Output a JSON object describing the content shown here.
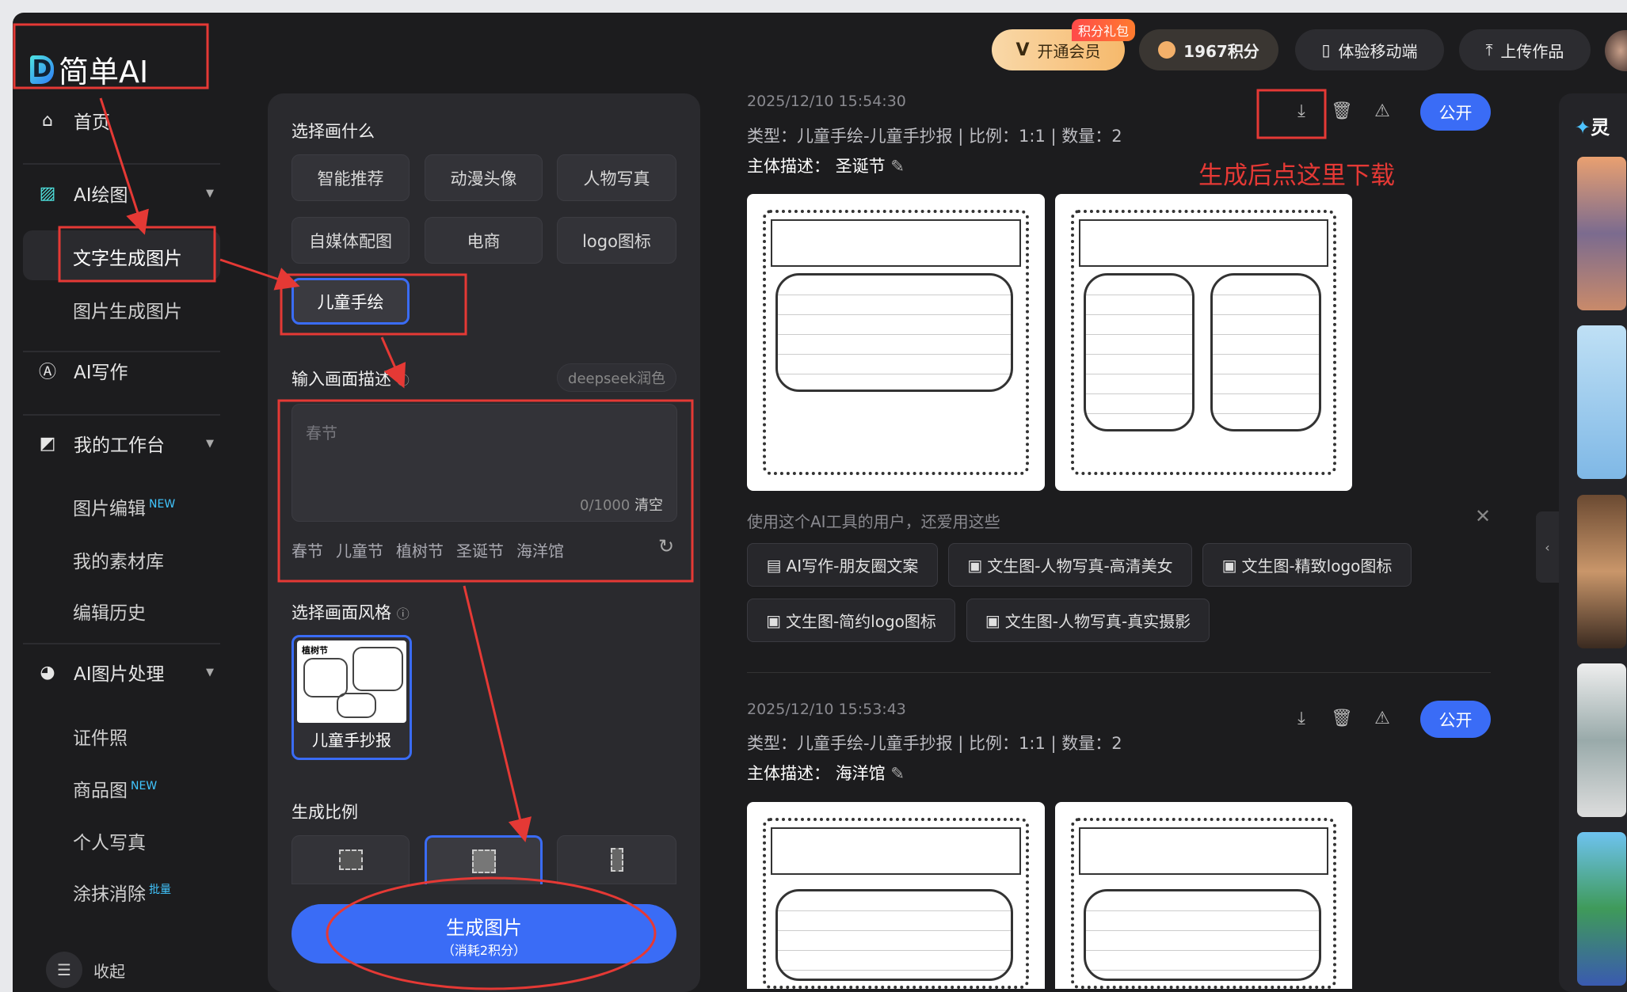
{
  "brand": {
    "name": "简单AI",
    "logo_letter": "D"
  },
  "sidebar": {
    "items": [
      {
        "label": "首页",
        "icon": "home-icon"
      },
      {
        "label": "AI绘图",
        "icon": "image-icon"
      },
      {
        "label": "文字生成图片"
      },
      {
        "label": "图片生成图片"
      },
      {
        "label": "AI写作",
        "icon": "ai-write-icon"
      },
      {
        "label": "我的工作台",
        "icon": "workspace-icon"
      },
      {
        "label": "图片编辑",
        "badge": "NEW"
      },
      {
        "label": "我的素材库"
      },
      {
        "label": "编辑历史"
      },
      {
        "label": "AI图片处理",
        "icon": "palette-icon"
      },
      {
        "label": "证件照"
      },
      {
        "label": "商品图",
        "badge": "NEW"
      },
      {
        "label": "个人写真"
      },
      {
        "label": "涂抹消除",
        "badge": "批量"
      }
    ],
    "collapse": "收起"
  },
  "form": {
    "what_title": "选择画什么",
    "categories": [
      "智能推荐",
      "动漫头像",
      "人物写真",
      "自媒体配图",
      "电商",
      "logo图标",
      "儿童手绘"
    ],
    "selected_category": "儿童手绘",
    "desc_title": "输入画面描述",
    "polish": "deepseek润色",
    "placeholder": "春节",
    "counter": "0/1000",
    "clear": "清空",
    "suggestions": [
      "春节",
      "儿童节",
      "植树节",
      "圣诞节",
      "海洋馆"
    ],
    "style_title": "选择画面风格",
    "style_name": "儿童手抄报",
    "style_thumb_text": "植树节",
    "ratio_title": "生成比例",
    "generate": "生成图片",
    "generate_cost": "（消耗2积分）"
  },
  "header": {
    "vip": "开通会员",
    "vip_badge": "积分礼包",
    "points": "1967积分",
    "mobile": "体验移动端",
    "upload": "上传作品"
  },
  "records": [
    {
      "date": "2025/12/10 15:54:30",
      "type": "类型：儿童手绘-儿童手抄报 | 比例：1:1 | 数量：2",
      "subject_label": "主体描述：",
      "subject": "圣诞节",
      "public": "公开"
    },
    {
      "date": "2025/12/10 15:53:43",
      "type": "类型：儿童手绘-儿童手抄报 | 比例：1:1 | 数量：2",
      "subject_label": "主体描述：",
      "subject": "海洋馆",
      "public": "公开"
    }
  ],
  "annotation": "生成后点这里下载",
  "recommend": {
    "title": "使用这个AI工具的用户，还爱用这些",
    "chips": [
      "AI写作-朋友圈文案",
      "文生图-人物写真-高清美女",
      "文生图-精致logo图标",
      "文生图-简约logo图标",
      "文生图-人物写真-真实摄影"
    ]
  },
  "right_panel": {
    "title": "灵"
  },
  "colors": {
    "accent": "#3a6cf6",
    "annotation_red": "#e53935",
    "bg": "#1c1c1e",
    "panel": "#2a2a2e"
  }
}
